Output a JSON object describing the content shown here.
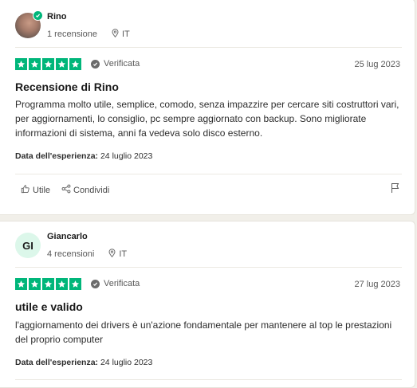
{
  "colors": {
    "trustpilot_green": "#00b67a",
    "page_bg": "#f1efe9"
  },
  "reviews": [
    {
      "author": "Rino",
      "review_count": "1 recensione",
      "country": "IT",
      "rating": 5,
      "verified_label": "Verificata",
      "date": "25 lug 2023",
      "title": "Recensione di Rino",
      "body": "Programma molto utile, semplice, comodo, senza impazzire per cercare siti costruttori vari, per aggiornamenti, lo consiglio, pc sempre aggiornato con backup. Sono migliorate informazioni di sistema, anni fa vedeva solo disco esterno.",
      "experience_label": "Data dell'esperienza:",
      "experience_date": "24 luglio 2023",
      "useful_label": "Utile",
      "share_label": "Condividi"
    },
    {
      "author": "Giancarlo",
      "initials": "GI",
      "review_count": "4 recensioni",
      "country": "IT",
      "rating": 5,
      "verified_label": "Verificata",
      "date": "27 lug 2023",
      "title": "utile e valido",
      "body": "l'aggiornamento dei drivers è un'azione fondamentale per mantenere al top le prestazioni del proprio computer",
      "experience_label": "Data dell'esperienza:",
      "experience_date": "24 luglio 2023"
    }
  ]
}
